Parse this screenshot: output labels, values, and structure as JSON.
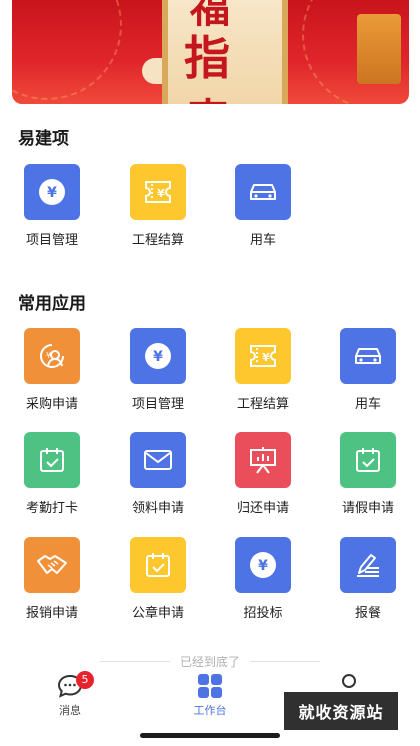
{
  "banner": {
    "chars": [
      "福",
      "指",
      "南"
    ]
  },
  "sections": {
    "easy_build": {
      "title": "易建项",
      "items": [
        {
          "label": "项目管理",
          "icon": "yen-icon",
          "color": "blue"
        },
        {
          "label": "工程结算",
          "icon": "ticket-yen-icon",
          "color": "yellow"
        },
        {
          "label": "用车",
          "icon": "car-icon",
          "color": "blue"
        }
      ]
    },
    "common_apps": {
      "title": "常用应用",
      "items": [
        {
          "label": "采购申请",
          "icon": "purchase-person-icon",
          "color": "orange"
        },
        {
          "label": "项目管理",
          "icon": "yen-icon",
          "color": "blue"
        },
        {
          "label": "工程结算",
          "icon": "ticket-yen-icon",
          "color": "yellow"
        },
        {
          "label": "用车",
          "icon": "car-icon",
          "color": "blue"
        },
        {
          "label": "考勤打卡",
          "icon": "calendar-check-icon",
          "color": "green"
        },
        {
          "label": "领料申请",
          "icon": "envelope-icon",
          "color": "blue"
        },
        {
          "label": "归还申请",
          "icon": "presentation-icon",
          "color": "red"
        },
        {
          "label": "请假申请",
          "icon": "calendar-check-icon",
          "color": "green"
        },
        {
          "label": "报销申请",
          "icon": "handshake-icon",
          "color": "orange"
        },
        {
          "label": "公章申请",
          "icon": "calendar-check-icon",
          "color": "yellow"
        },
        {
          "label": "招投标",
          "icon": "yen-icon",
          "color": "blue"
        },
        {
          "label": "报餐",
          "icon": "pen-lines-icon",
          "color": "blue"
        }
      ]
    }
  },
  "end_note": "已经到底了",
  "tabbar": {
    "messages": {
      "label": "消息",
      "badge": "5"
    },
    "workbench": {
      "label": "工作台"
    }
  },
  "watermark": "就收资源站",
  "colors": {
    "blue": "#4d73e4",
    "yellow": "#fec72e",
    "orange": "#f0913a",
    "green": "#4dc283",
    "red": "#ea4e5a",
    "badge": "#e8232d"
  }
}
